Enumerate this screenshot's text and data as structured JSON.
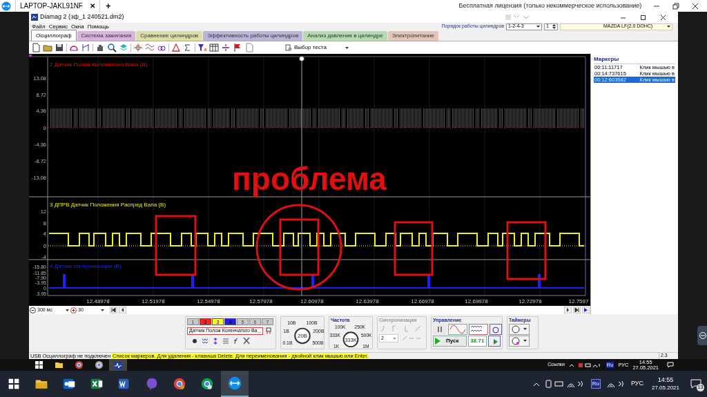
{
  "remote_tab": {
    "label": "LAPTOP-JAKL91NF",
    "close": "✕",
    "add": "+"
  },
  "license": "Бесплатная лицензия (только некоммерческое использование)",
  "window": {
    "title": "Diamag 2 (эф_1 240521.dm2)"
  },
  "menu": [
    "Файл",
    "Сервис",
    "Окна",
    "Помощь"
  ],
  "cylinder_order": {
    "label": "Порядок работы цилиндров",
    "value": "1-2-4-3",
    "spinner": "1"
  },
  "engine": "MAZDA LF(2,0 DOHC)",
  "tabs": [
    {
      "label": "Осциллограф",
      "selected": true,
      "color": "#ffffff"
    },
    {
      "label": "Система зажигания",
      "selected": false,
      "color": "#d8b4dc"
    },
    {
      "label": "Сравнение цилиндров",
      "selected": false,
      "color": "#dedca8"
    },
    {
      "label": "Эффективность работы цилиндров",
      "selected": false,
      "color": "#b9b4d8"
    },
    {
      "label": "Анализ давления в цилиндре",
      "selected": false,
      "color": "#b4dab0"
    },
    {
      "label": "Электропитание",
      "selected": false,
      "color": "#e2c4b8"
    }
  ],
  "test_select": "Выбор теста",
  "channels": [
    {
      "kind": "crank",
      "title": "2 Датчик Полож Коленчатого Вала (В)",
      "color": "#ff0000",
      "ticks": [
        "13.08",
        "8.72",
        "4.36",
        "0",
        "-4.36",
        "-8.72",
        "-13.08"
      ]
    },
    {
      "kind": "cam",
      "title": "3 ДПРВ Датчик Положения Распред Вала (В)",
      "color": "#f0f020",
      "ticks": [
        "12",
        "8",
        "4",
        "0",
        "-4"
      ]
    },
    {
      "kind": "sync",
      "title": "4 Датчик синхронизации (В)",
      "color": "#2020ff",
      "ticks": [
        "-15.80",
        "-11.85",
        "-7.90",
        "-3.95",
        "0",
        "3.95"
      ]
    }
  ],
  "x_labels": [
    "12.48978",
    "12.51978",
    "12.54978",
    "12.57978",
    "12.60978",
    "12.63978",
    "12.66978",
    "12.69978",
    "12.72978",
    "12.7597"
  ],
  "annotation": "проблема",
  "markers": {
    "title": "Маркеры",
    "items": [
      {
        "time": "00:11:11717",
        "note": "Клик мышью в",
        "selected": false
      },
      {
        "time": "00:14:737615",
        "note": "Клик мышью в",
        "selected": false
      },
      {
        "time": "00:12:603582",
        "note": "Клик мышью в",
        "selected": true
      }
    ]
  },
  "timebase": "300 мс",
  "zoom": "30",
  "channel_buttons": [
    {
      "label": "1",
      "color": "#c8c8c8",
      "enabled": false
    },
    {
      "label": "2",
      "color": "#ff2020",
      "enabled": true
    },
    {
      "label": "3",
      "color": "#ffff30",
      "enabled": true
    },
    {
      "label": "4",
      "color": "#2020e0",
      "enabled": true
    },
    {
      "label": "5",
      "color": "#c8c8c8",
      "enabled": false
    },
    {
      "label": "6",
      "color": "#c8c8c8",
      "enabled": false
    },
    {
      "label": "7",
      "color": "#c8c8c8",
      "enabled": false
    }
  ],
  "signal_select": "Датчик Полож Коленчатого Ва",
  "signal_more": "...",
  "voltage": {
    "labels": [
      "10В",
      "100В",
      "1В",
      "200В",
      "0.1В",
      "500В"
    ],
    "value": "20В"
  },
  "frequency": {
    "title": "Частота",
    "labels": [
      "100K",
      "250K",
      "333K",
      "500K",
      "1K",
      "1M"
    ],
    "value": "333K"
  },
  "sync": {
    "title": "Синхронизация",
    "value": "2"
  },
  "control": {
    "title": "Управление",
    "start": "Пуск",
    "reading": "38.71"
  },
  "timers": {
    "title": "Таймеры"
  },
  "status": {
    "connection": "USB Осциллограф не подключен",
    "hint": "Список маркеров. Для удаления - клавиша Delete. Для переименования - двойной клик мышью или Enter.",
    "version": "2.3"
  },
  "remote_taskbar": {
    "links": "Ссылки",
    "lang_badge": "Ru",
    "lang": "РУС",
    "time": "14:55",
    "date": "27.05.2021"
  },
  "taskbar": {
    "lang_badge": "Ru",
    "lang": "РУС",
    "time": "14:55",
    "date": "27.05.2021",
    "notifications": "13"
  }
}
